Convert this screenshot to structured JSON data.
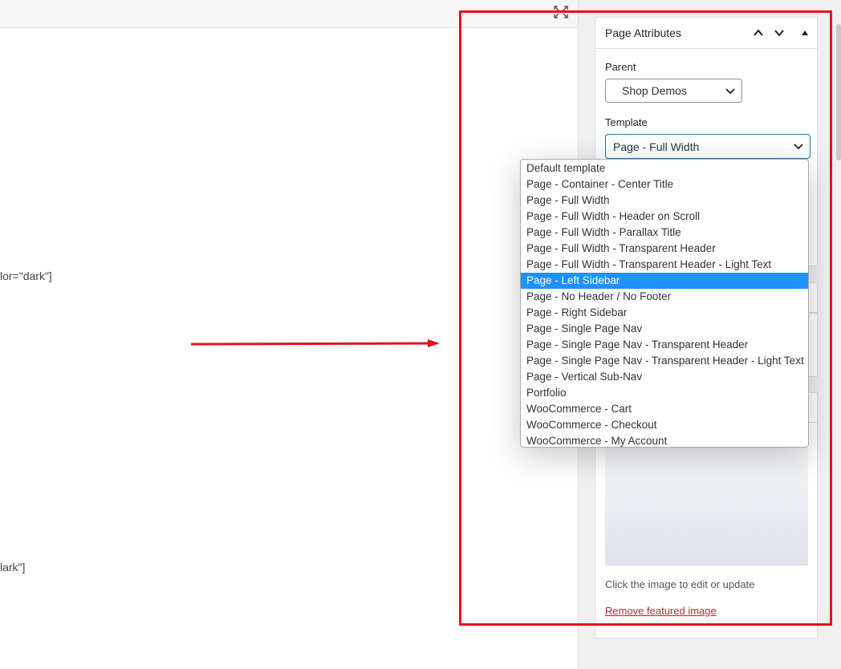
{
  "editor": {
    "code_line_1": "lor=\"dark\"]",
    "code_line_2": "lark\"]"
  },
  "page_attributes": {
    "title": "Page Attributes",
    "parent_label": "Parent",
    "parent_value": "Shop Demos",
    "template_label": "Template",
    "template_value": "Page - Full Width"
  },
  "template_options": [
    "Default template",
    "Page - Container - Center Title",
    "Page - Full Width",
    "Page - Full Width - Header on Scroll",
    "Page - Full Width - Parallax Title",
    "Page - Full Width - Transparent Header",
    "Page - Full Width - Transparent Header - Light Text",
    "Page - Left Sidebar",
    "Page - No Header / No Footer",
    "Page - Right Sidebar",
    "Page - Single Page Nav",
    "Page - Single Page Nav - Transparent Header",
    "Page - Single Page Nav - Transparent Header - Light Text",
    "Page - Vertical Sub-Nav",
    "Portfolio",
    "WooCommerce - Cart",
    "WooCommerce - Checkout",
    "WooCommerce - My Account"
  ],
  "highlighted_option": "Page - Left Sidebar",
  "featured_image": {
    "caption": "Click the image to edit or update",
    "remove_link": "Remove featured image"
  },
  "colors": {
    "highlight": "#1e90ff",
    "annotation_red": "#e0151b",
    "link_red": "#b32d2e"
  },
  "icons": [
    "fullscreen-icon",
    "chevron-up-icon",
    "chevron-down-icon",
    "collapse-triangle-icon",
    "select-chevron-icon"
  ]
}
